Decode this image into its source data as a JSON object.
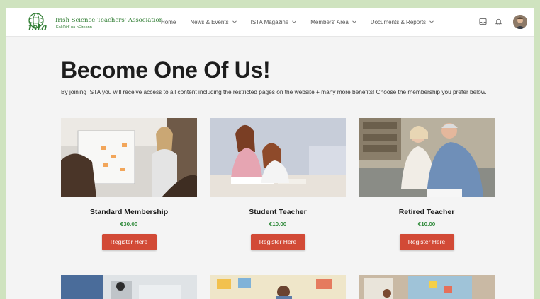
{
  "header": {
    "org_name": "Irish Science Teachers' Association",
    "org_sub": "Eol Oidí na hÉireann",
    "nav": [
      {
        "label": "Home",
        "dropdown": false
      },
      {
        "label": "News & Events",
        "dropdown": true
      },
      {
        "label": "ISTA Magazine",
        "dropdown": true
      },
      {
        "label": "Members' Area",
        "dropdown": true
      },
      {
        "label": "Documents & Reports",
        "dropdown": true
      }
    ],
    "icons": [
      "inbox-icon",
      "bell-icon",
      "avatar"
    ]
  },
  "main": {
    "title": "Become One Of Us!",
    "intro": "By joining ISTA you will receive access to all content including the restricted pages on the website + many more benefits! Choose the membership you prefer below.",
    "cards": [
      {
        "title": "Standard Membership",
        "price": "€30.00",
        "button": "Register Here"
      },
      {
        "title": "Student Teacher",
        "price": "€10.00",
        "button": "Register Here"
      },
      {
        "title": "Retired Teacher",
        "price": "€10.00",
        "button": "Register Here"
      }
    ]
  },
  "colors": {
    "accent_button": "#d24a36",
    "price_green": "#2f8a3a",
    "brand_green": "#2f7d32",
    "page_border": "#cfe3bf"
  }
}
